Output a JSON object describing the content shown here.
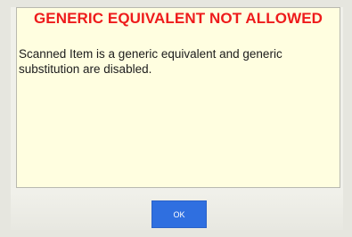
{
  "dialog": {
    "title": "GENERIC EQUIVALENT NOT ALLOWED",
    "message": "Scanned Item is a generic equivalent and generic substitution are disabled.",
    "ok_label": "OK"
  },
  "colors": {
    "title": "#ee1b1b",
    "panel_background": "#fffee0",
    "button": "#2f6fe0"
  }
}
